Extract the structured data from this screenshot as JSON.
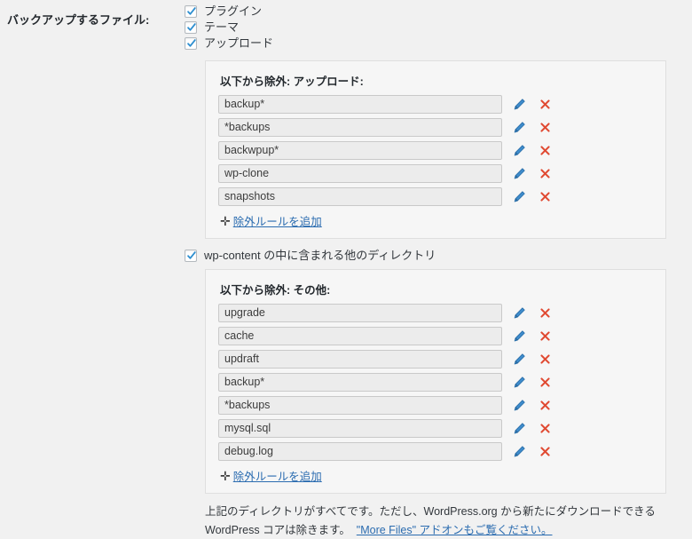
{
  "form": {
    "label": "バックアップするファイル:"
  },
  "checkboxes": [
    {
      "label": "プラグイン",
      "checked": true
    },
    {
      "label": "テーマ",
      "checked": true
    },
    {
      "label": "アップロード",
      "checked": true
    }
  ],
  "uploads_panel": {
    "title": "以下から除外: アップロード:",
    "rules": [
      "backup*",
      "*backups",
      "backwpup*",
      "wp-clone",
      "snapshots"
    ],
    "add_label": "除外ルールを追加",
    "plus_glyph": "✛"
  },
  "others_checkbox": {
    "label": "wp-content の中に含まれる他のディレクトリ",
    "checked": true
  },
  "others_panel": {
    "title": "以下から除外: その他:",
    "rules": [
      "upgrade",
      "cache",
      "updraft",
      "backup*",
      "*backups",
      "mysql.sql",
      "debug.log"
    ],
    "add_label": "除外ルールを追加",
    "plus_glyph": "✛"
  },
  "note": {
    "text": "上記のディレクトリがすべてです。ただし、WordPress.org から新たにダウンロードできる WordPress コアは除きます。",
    "link": "\"More Files\" アドオンもご覧ください。"
  },
  "icons": {
    "edit": "pencil-icon",
    "delete": "x-icon",
    "check": "check-icon"
  },
  "colors": {
    "link": "#2b6cb0",
    "delete": "#e04a32",
    "edit": "#2e7bbf",
    "check": "#2e8fd0",
    "page_bg": "#f1f1f1",
    "panel_bg": "#f6f6f6",
    "panel_border": "#dfdfdf",
    "input_bg": "#ececec"
  }
}
